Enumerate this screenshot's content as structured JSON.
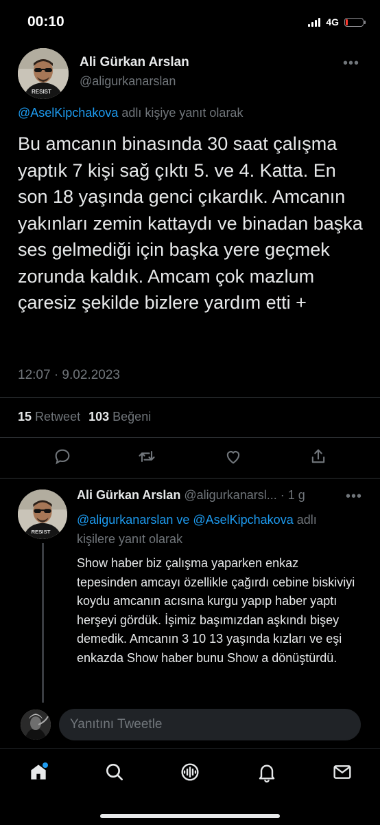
{
  "status_bar": {
    "time": "00:10",
    "network": "4G"
  },
  "main_tweet": {
    "author_name": "Ali Gürkan Arslan",
    "author_handle": "@aligurkanarslan",
    "reply_to_mention": "@AselKipchakova",
    "reply_to_suffix": " adlı kişiye yanıt olarak",
    "text": "Bu amcanın binasında 30 saat çalışma yaptık 7 kişi sağ çıktı 5. ve 4. Katta. En son 18 yaşında genci çıkardık. Amcanın yakınları zemin kattaydı ve binadan başka ses gelmediği için başka yere geçmek zorunda kaldık. Amcam çok mazlum çaresiz şekilde bizlere yardım etti +",
    "timestamp": "12:07 · 9.02.2023",
    "retweet_count": "15",
    "retweet_label": "Retweet",
    "like_count": "103",
    "like_label": "Beğeni"
  },
  "reply_tweet": {
    "author_name": "Ali Gürkan Arslan",
    "author_handle": "@aligurkanarsl...",
    "age": "· 1 g",
    "mention_1": "@aligurkanarslan",
    "connector": " ve ",
    "mention_2": "@AselKipchakova",
    "meta_suffix": " adlı kişilere yanıt olarak",
    "text": "Show haber biz çalışma yaparken enkaz tepesinden amcayı özellikle çağırdı cebine biskiviyi koydu amcanın acısına kurgu yapıp haber yaptı herşeyi gördük. İşimiz başımızdan aşkındı bişey demedik. Amcanın 3 10 13 yaşında kızları ve eşi enkazda Show haber bunu Show a dönüştürdü."
  },
  "composer": {
    "placeholder": "Yanıtını Tweetle"
  },
  "tab_bar": {
    "items": [
      "home-icon",
      "search-icon",
      "spaces-icon",
      "notifications-icon",
      "messages-icon"
    ]
  },
  "colors": {
    "background": "#000000",
    "text": "#e7e9ea",
    "muted": "#71767b",
    "accent": "#1d9bf0",
    "divider": "#2f3336"
  }
}
